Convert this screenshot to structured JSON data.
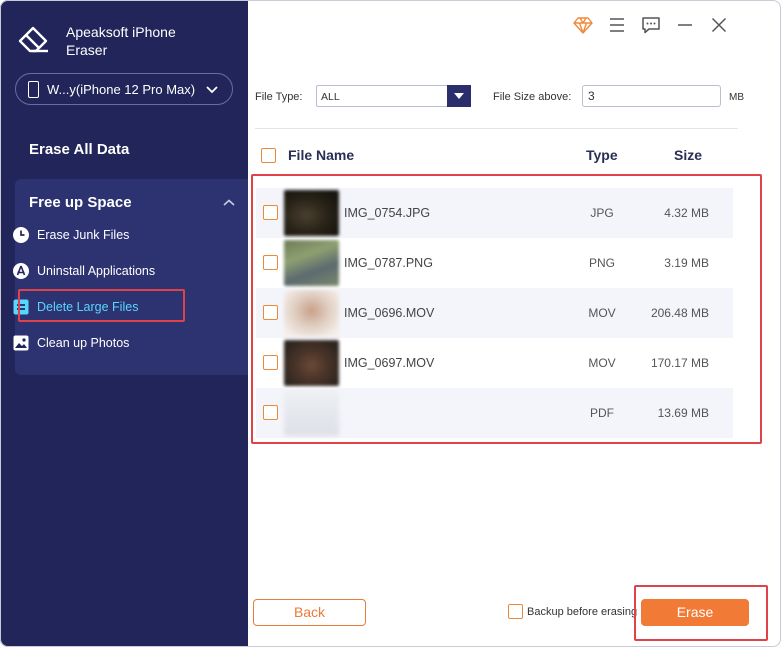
{
  "app": {
    "name": "Apeaksoft iPhone Eraser",
    "device": "W...y(iPhone 12 Pro Max)"
  },
  "sidebar": {
    "erase_all": "Erase All Data",
    "free_up_space": "Free up Space",
    "items": [
      {
        "label": "Erase Junk Files",
        "icon": "clock-icon"
      },
      {
        "label": "Uninstall Applications",
        "icon": "app-store-icon"
      },
      {
        "label": "Delete Large Files",
        "icon": "large-file-icon",
        "active": true
      },
      {
        "label": "Clean up Photos",
        "icon": "photo-icon"
      }
    ]
  },
  "filters": {
    "file_type_label": "File Type:",
    "file_type_value": "ALL",
    "file_size_label": "File Size above:",
    "file_size_value": "3",
    "file_size_unit": "MB"
  },
  "table": {
    "headers": {
      "name": "File Name",
      "type": "Type",
      "size": "Size"
    },
    "rows": [
      {
        "name": "IMG_0754.JPG",
        "type": "JPG",
        "size": "4.32 MB"
      },
      {
        "name": "IMG_0787.PNG",
        "type": "PNG",
        "size": "3.19 MB"
      },
      {
        "name": "IMG_0696.MOV",
        "type": "MOV",
        "size": "206.48 MB"
      },
      {
        "name": "IMG_0697.MOV",
        "type": "MOV",
        "size": "170.17 MB"
      },
      {
        "name": "",
        "type": "PDF",
        "size": "13.69 MB"
      }
    ]
  },
  "footer": {
    "back": "Back",
    "backup": "Backup before erasing",
    "erase": "Erase"
  },
  "colors": {
    "sidebar_bg": "#212559",
    "accent_orange": "#f07a36",
    "active_item": "#59d6ff",
    "highlight_red": "#e0424a"
  }
}
